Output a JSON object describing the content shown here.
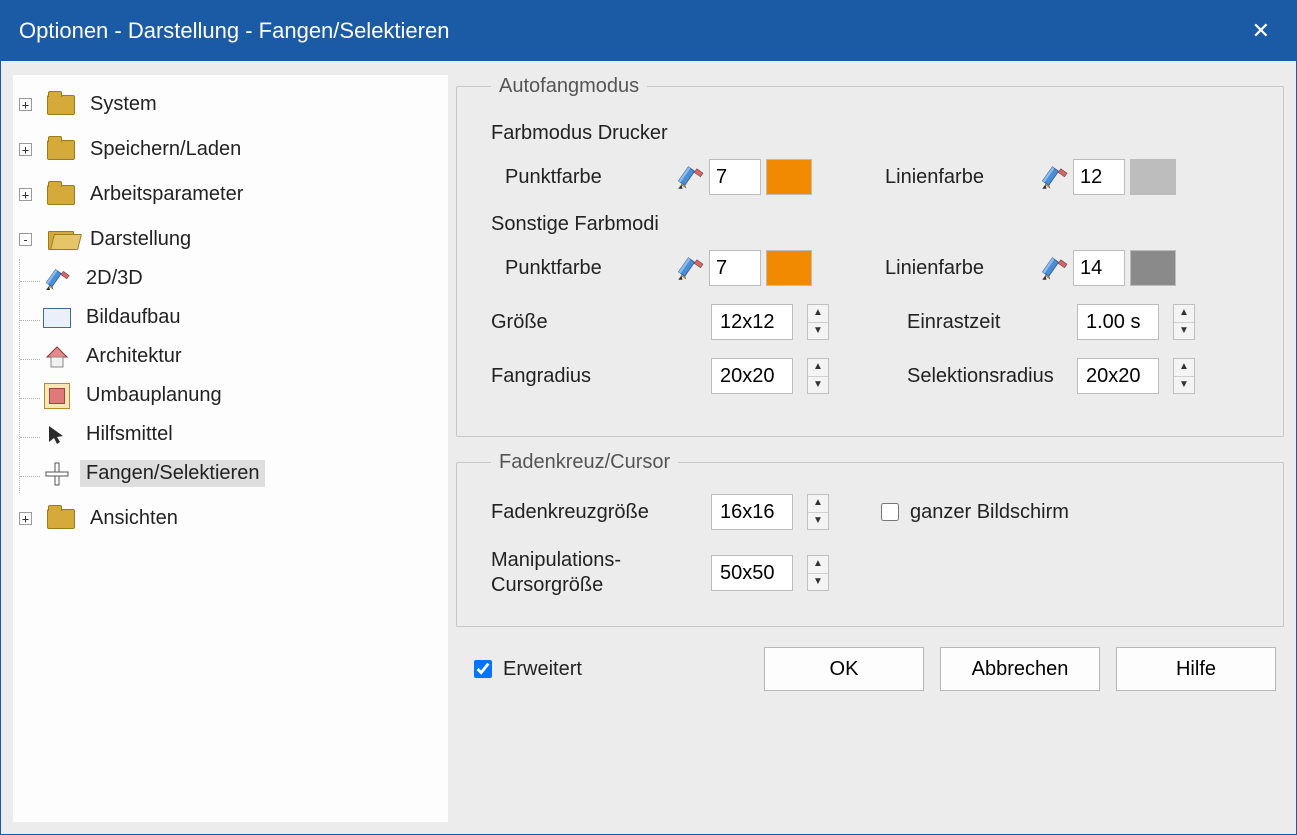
{
  "title": "Optionen - Darstellung - Fangen/Selektieren",
  "tree": {
    "system": "System",
    "speichern": "Speichern/Laden",
    "arbeitsparameter": "Arbeitsparameter",
    "darstellung": "Darstellung",
    "children": {
      "d2d3d": "2D/3D",
      "bildaufbau": "Bildaufbau",
      "architektur": "Architektur",
      "umbauplanung": "Umbauplanung",
      "hilfsmittel": "Hilfsmittel",
      "fangen": "Fangen/Selektieren"
    },
    "ansichten": "Ansichten"
  },
  "groups": {
    "autofang": {
      "legend": "Autofangmodus",
      "farbmodus_drucker": "Farbmodus Drucker",
      "sonstige_farbmodi": "Sonstige Farbmodi",
      "punktfarbe_label": "Punktfarbe",
      "linienfarbe_label": "Linienfarbe",
      "drucker_punktfarbe_value": "7",
      "drucker_punktfarbe_color": "#f28a00",
      "drucker_linienfarbe_value": "12",
      "drucker_linienfarbe_color": "#bdbdbd",
      "sonstige_punktfarbe_value": "7",
      "sonstige_punktfarbe_color": "#f28a00",
      "sonstige_linienfarbe_value": "14",
      "sonstige_linienfarbe_color": "#8a8a8a",
      "groesse_label": "Größe",
      "groesse_value": "12x12",
      "einrastzeit_label": "Einrastzeit",
      "einrastzeit_value": "1.00 s",
      "fangradius_label": "Fangradius",
      "fangradius_value": "20x20",
      "selektionsradius_label": "Selektionsradius",
      "selektionsradius_value": "20x20"
    },
    "cursor": {
      "legend": "Fadenkreuz/Cursor",
      "fadenkreuz_label": "Fadenkreuzgröße",
      "fadenkreuz_value": "16x16",
      "ganzer_bildschirm_label": "ganzer Bildschirm",
      "manip_label_a": "Manipulations-",
      "manip_label_b": "Cursorgröße",
      "manip_value": "50x50"
    }
  },
  "footer": {
    "erweitert": "Erweitert",
    "ok": "OK",
    "abbrechen": "Abbrechen",
    "hilfe": "Hilfe"
  }
}
